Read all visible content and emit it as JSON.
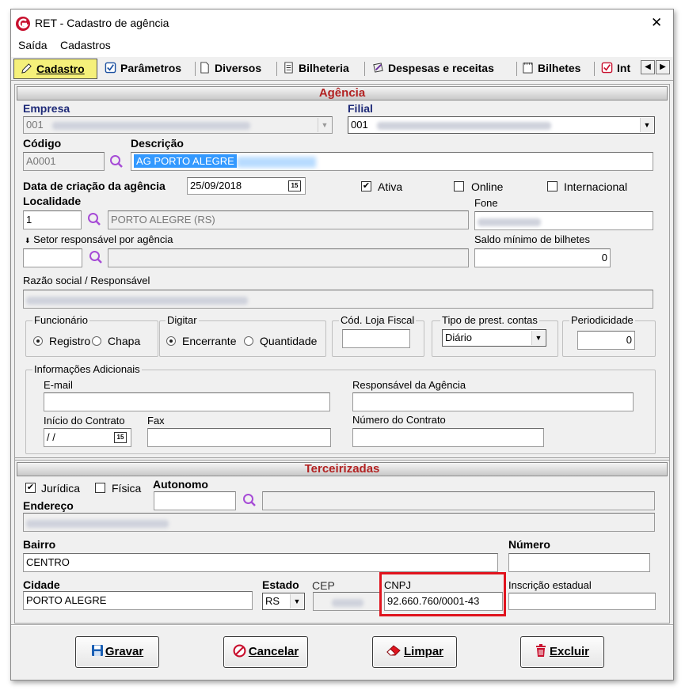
{
  "window": {
    "title": "RET - Cadastro de agência",
    "close_symbol": "✕"
  },
  "menu": [
    "Saída",
    "Cadastros"
  ],
  "tabs": [
    {
      "label": "Cadastro",
      "icon": "pencil-icon",
      "active": true
    },
    {
      "label": "Parâmetros",
      "icon": "checkbox-icon"
    },
    {
      "label": "Diversos",
      "icon": "document-icon"
    },
    {
      "label": "Bilheteria",
      "icon": "document-lines-icon"
    },
    {
      "label": "Despesas e receitas",
      "icon": "pen-paper-icon"
    },
    {
      "label": "Bilhetes",
      "icon": "notepad-icon"
    },
    {
      "label": "Int",
      "icon": "red-check-icon"
    }
  ],
  "agencia": {
    "section_title": "Agência",
    "empresa": {
      "label": "Empresa",
      "value": "001"
    },
    "filial": {
      "label": "Filial",
      "value": "001"
    },
    "codigo": {
      "label": "Código",
      "value": "A0001"
    },
    "descricao": {
      "label": "Descrição",
      "value": "AG PORTO ALEGRE"
    },
    "data_criacao": {
      "label": "Data de criação da agência",
      "value": "25/09/2018"
    },
    "ativa": {
      "label": "Ativa",
      "checked": true
    },
    "online": {
      "label": "Online",
      "checked": false
    },
    "internacional": {
      "label": "Internacional",
      "checked": false
    },
    "localidade": {
      "label": "Localidade",
      "code": "1",
      "name": "PORTO ALEGRE (RS)"
    },
    "fone": {
      "label": "Fone"
    },
    "setor": {
      "label": "Setor responsável por agência"
    },
    "saldo_minimo": {
      "label": "Saldo mínimo de bilhetes",
      "value": "0"
    },
    "razao_social": {
      "label": "Razão social / Responsável"
    },
    "funcionario": {
      "title": "Funcionário",
      "opt1": "Registro",
      "opt2": "Chapa",
      "selected": "Registro"
    },
    "digitar": {
      "title": "Digitar",
      "opt1": "Encerrante",
      "opt2": "Quantidade",
      "selected": "Encerrante"
    },
    "cod_loja_fiscal": {
      "title": "Cód. Loja Fiscal"
    },
    "tipo_prest": {
      "title": "Tipo de prest. contas",
      "value": "Diário"
    },
    "periodicidade": {
      "title": "Periodicidade",
      "value": "0"
    },
    "info_adicionais": {
      "title": "Informações Adicionais",
      "email": "E-mail",
      "responsavel": "Responsável da Agência",
      "inicio_contrato": "Início do Contrato",
      "inicio_value": " / /",
      "fax": "Fax",
      "numero_contrato": "Número do Contrato"
    }
  },
  "terceirizadas": {
    "section_title": "Terceirizadas",
    "juridica": {
      "label": "Jurídica",
      "checked": true
    },
    "fisica": {
      "label": "Física",
      "checked": false
    },
    "autonomo": "Autonomo",
    "endereco": "Endereço",
    "bairro": {
      "label": "Bairro",
      "value": "CENTRO"
    },
    "numero": "Número",
    "cidade": {
      "label": "Cidade",
      "value": "PORTO ALEGRE"
    },
    "estado": {
      "label": "Estado",
      "value": "RS"
    },
    "cep": "CEP",
    "cnpj": {
      "label": "CNPJ",
      "value": "92.660.760/0001-43"
    },
    "inscricao": "Inscrição estadual"
  },
  "buttons": {
    "gravar": "Gravar",
    "cancelar": "Cancelar",
    "limpar": "Limpar",
    "excluir": "Excluir"
  },
  "colors": {
    "section_title": "#b22222",
    "highlight_box": "#e0141e",
    "selection": "#3399ff",
    "active_tab": "#f5f07a"
  }
}
